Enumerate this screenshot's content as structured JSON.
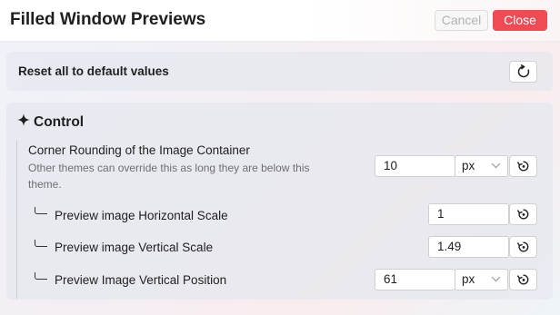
{
  "window": {
    "title": "Filled Window Previews",
    "cancel_label": "Cancel",
    "close_label": "Close"
  },
  "reset": {
    "label": "Reset all to default values",
    "icon": "reset-icon"
  },
  "control": {
    "title": "Control",
    "icon": "sparkle-icon",
    "options": [
      {
        "label": "Corner Rounding of the Image Container",
        "description": "Other themes can override this as long they are below this theme.",
        "value": "10",
        "unit": "px"
      },
      {
        "label": "Preview image Horizontal Scale",
        "value": "1"
      },
      {
        "label": "Preview image Vertical Scale",
        "value": "1.49"
      },
      {
        "label": "Preview Image Vertical Position",
        "value": "61",
        "unit": "px"
      }
    ]
  },
  "colors": {
    "close_button": "#ef4b55",
    "card_background": "#e4e8ee"
  }
}
